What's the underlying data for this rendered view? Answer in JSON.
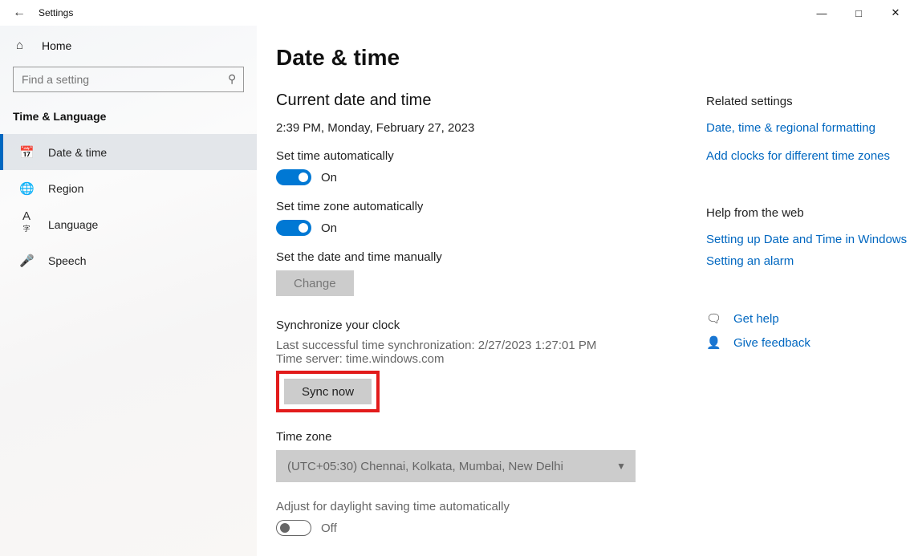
{
  "window": {
    "title": "Settings"
  },
  "sidebar": {
    "home": "Home",
    "searchPlaceholder": "Find a setting",
    "group": "Time & Language",
    "items": [
      {
        "label": "Date & time"
      },
      {
        "label": "Region"
      },
      {
        "label": "Language"
      },
      {
        "label": "Speech"
      }
    ]
  },
  "page": {
    "heading": "Date & time",
    "currentHeading": "Current date and time",
    "currentValue": "2:39 PM, Monday, February 27, 2023",
    "autoTimeLabel": "Set time automatically",
    "autoTimeState": "On",
    "autoZoneLabel": "Set time zone automatically",
    "autoZoneState": "On",
    "manualLabel": "Set the date and time manually",
    "changeBtn": "Change",
    "syncHeading": "Synchronize your clock",
    "syncLast": "Last successful time synchronization: 2/27/2023 1:27:01 PM",
    "syncServer": "Time server: time.windows.com",
    "syncBtn": "Sync now",
    "tzHeading": "Time zone",
    "tzValue": "(UTC+05:30) Chennai, Kolkata, Mumbai, New Delhi",
    "dstLabel": "Adjust for daylight saving time automatically",
    "dstState": "Off"
  },
  "aside": {
    "relatedHeading": "Related settings",
    "links": [
      "Date, time & regional formatting",
      "Add clocks for different time zones"
    ],
    "helpHeading": "Help from the web",
    "helpLinks": [
      "Setting up Date and Time in Windows",
      "Setting an alarm"
    ],
    "getHelp": "Get help",
    "feedback": "Give feedback"
  }
}
